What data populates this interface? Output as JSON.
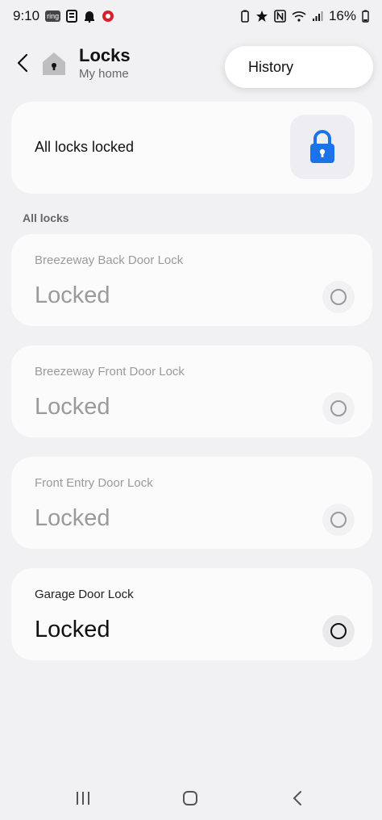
{
  "status_bar": {
    "time": "9:10",
    "app_icon_ring": "ring",
    "battery": "16%"
  },
  "header": {
    "title": "Locks",
    "subtitle": "My home"
  },
  "menu": {
    "history": "History"
  },
  "summary": {
    "text": "All locks locked",
    "accent_color": "#1a73e8"
  },
  "section": {
    "label": "All locks"
  },
  "locks": [
    {
      "name": "Breezeway Back Door Lock",
      "state": "Locked"
    },
    {
      "name": "Breezeway Front Door Lock",
      "state": "Locked"
    },
    {
      "name": "Front Entry Door Lock",
      "state": "Locked"
    },
    {
      "name": "Garage Door Lock",
      "state": "Locked"
    }
  ]
}
